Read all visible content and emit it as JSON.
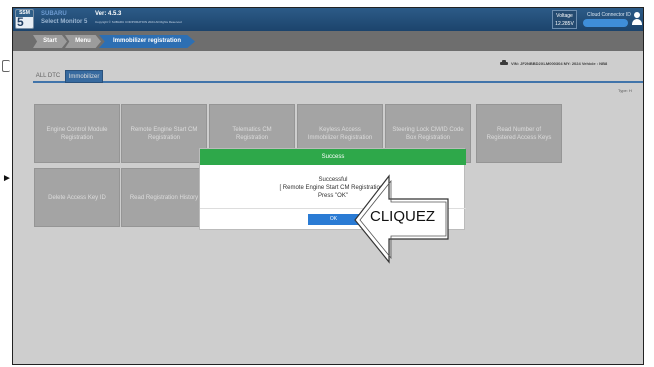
{
  "header": {
    "logo_top": "SSM",
    "logo_big": "5",
    "app_name": "SUBARU",
    "app_subtitle": "Select Monitor 5",
    "version": "Ver: 4.5.3",
    "copyright": "Copyright © SUBARU CORPORATION 2024 All Rights Reserved",
    "voltage_label": "Voltage",
    "voltage_value": "12.285V",
    "cloud_connector_label": "Cloud Connector ID"
  },
  "breadcrumb": [
    "Start",
    "Menu",
    "Immobilizer registration"
  ],
  "tabs": [
    "ALL DTC",
    "Immobilizer"
  ],
  "vehicle_info": "VIN: JF2NBBD2XLM000304  MY: 2024  Vehicle : NB8",
  "type_label": "Type:  H",
  "tiles": [
    "Engine Control Module Registration",
    "Remote Engine Start CM Registration",
    "Telematics CM Registration",
    "Keyless Access Immobilizer Registration",
    "Steering Lock CM/ID Code Box Registration",
    "Read Number of Registered Access Keys",
    "Delete Access Key ID",
    "Read Registration History"
  ],
  "dialog": {
    "title": "Success",
    "line1": "Successful",
    "line2": "[ Remote Engine Start CM Registration ]",
    "line3": "Press \"OK\"",
    "ok_label": "OK"
  },
  "annotation": {
    "callout_text": "CLIQUEZ"
  },
  "colors": {
    "header": "#1c446c",
    "accent": "#2d6fb3",
    "dialog_header": "#2ea84a",
    "tile": "#b9b9b9"
  }
}
